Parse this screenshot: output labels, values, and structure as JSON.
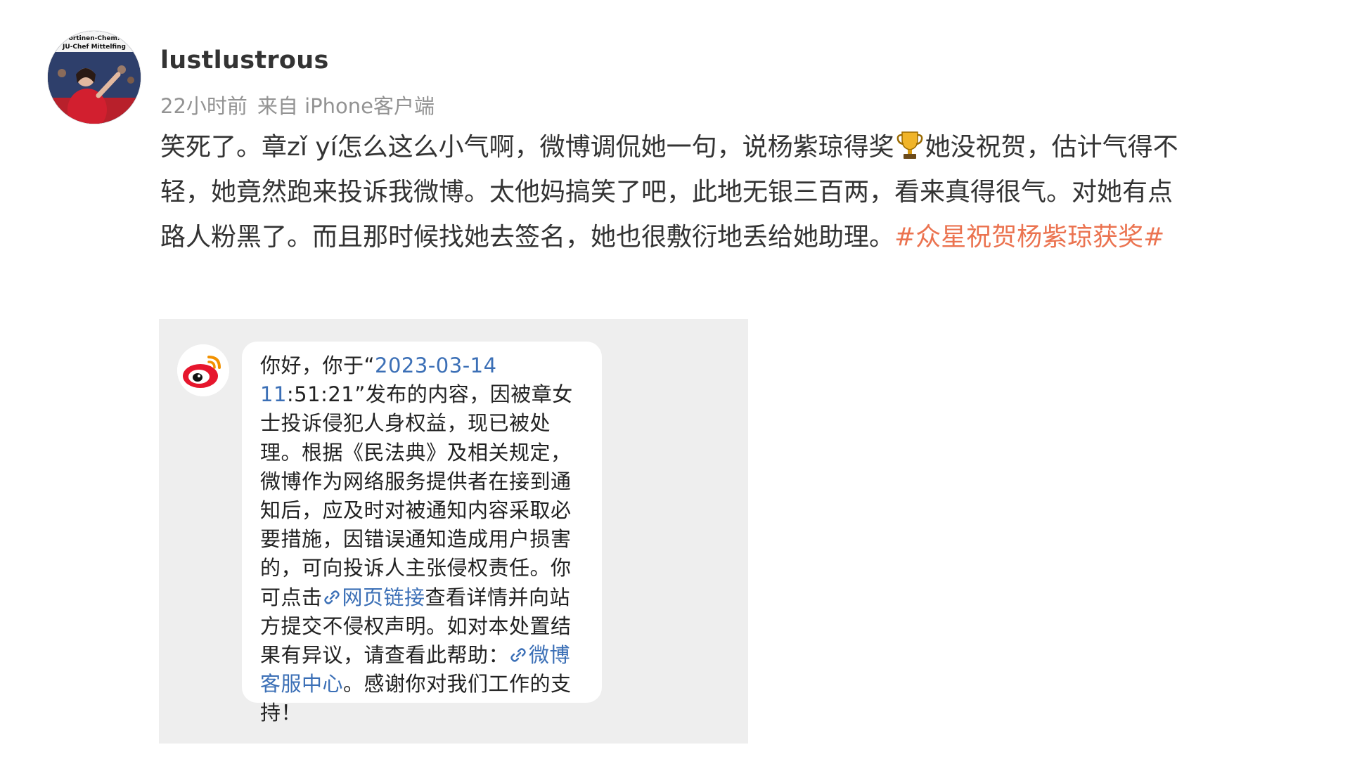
{
  "post": {
    "avatar_icon": "user-avatar",
    "avatar_caption_line1": "ortinen-Chem.",
    "avatar_caption_line2": "JU-Chef Mittelfing",
    "username": "lustlustrous",
    "time": "22小时前",
    "source": "来自 iPhone客户端",
    "text_part1": "笑死了。章zǐ yí怎么这么小气啊，微博调侃她一句，说杨紫琼得奖",
    "trophy_icon": "trophy-icon",
    "text_part2": "她没祝贺，估计气得不轻，她竟然跑来投诉我微博。太他妈搞笑了吧，此地无银三百两，看来真得很气。对她有点路人粉黑了。而且那时候找她去签名，她也很敷衍地丢给她助理。",
    "hashtag": "#众星祝贺杨紫琼获奖#"
  },
  "notice": {
    "logo_icon": "weibo-logo-icon",
    "intro": "你好，你于“",
    "datetime_link": "2023-03-14 11",
    "datetime_rest": ":51:21”发布的内容，因被章女士投诉侵犯人身权益，现已被处理。根据《民法典》及相关规定，微博作为网络服务提供者在接到通知后，应及时对被通知内容采取必要措施，因错误通知造成用户损害的，可向投诉人主张侵权责任。你可点击",
    "webpage_link": "网页链接",
    "mid_text": "查看详情并向站方提交不侵权声明。如对本处置结果有异议，请查看此帮助：",
    "service_link": "微博客服中心",
    "outro": "。感谢你对我们工作的支持！"
  },
  "colors": {
    "hashtag": "#eb7350",
    "link": "#3b6fb6",
    "embed_bg": "#eeeeee",
    "meta": "#939393"
  }
}
